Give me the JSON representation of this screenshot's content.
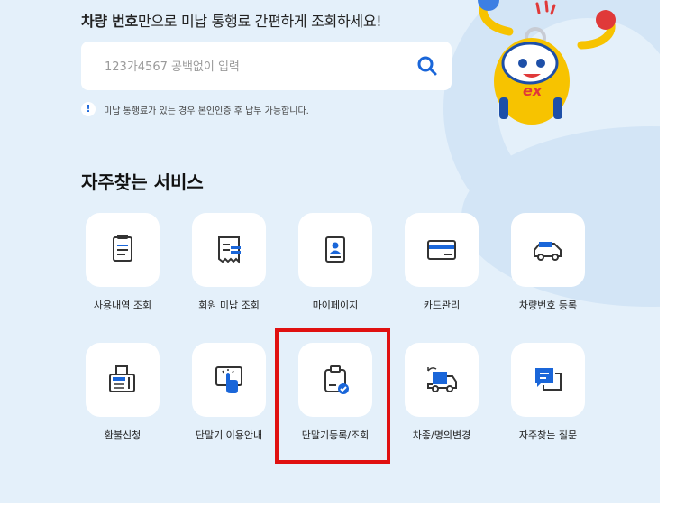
{
  "hero": {
    "headline_bold": "차량 번호",
    "headline_rest": "만으로 미납 통행료 간편하게 조회하세요!",
    "search_placeholder": "123가4567 공백없이 입력",
    "notice": "미납 통행료가 있는 경우 본인인증 후 납부 가능합니다.",
    "notice_mark": "!"
  },
  "mascot_text": "ex",
  "section_title": "자주찾는 서비스",
  "services": [
    {
      "label": "사용내역 조회",
      "icon": "receipt-list-icon"
    },
    {
      "label": "회원 미납 조회",
      "icon": "unpaid-receipt-icon"
    },
    {
      "label": "마이페이지",
      "icon": "profile-card-icon"
    },
    {
      "label": "카드관리",
      "icon": "credit-card-icon"
    },
    {
      "label": "차량번호 등록",
      "icon": "car-register-icon"
    },
    {
      "label": "환불신청",
      "icon": "fax-printer-icon"
    },
    {
      "label": "단말기 이용안내",
      "icon": "touch-terminal-icon"
    },
    {
      "label": "단말기등록/조회",
      "icon": "terminal-check-icon"
    },
    {
      "label": "차종/명의변경",
      "icon": "truck-change-icon"
    },
    {
      "label": "자주찾는 질문",
      "icon": "chat-bubble-icon"
    }
  ],
  "colors": {
    "accent": "#1a66d9",
    "background": "#e4f0fa",
    "highlight": "#e01010"
  }
}
